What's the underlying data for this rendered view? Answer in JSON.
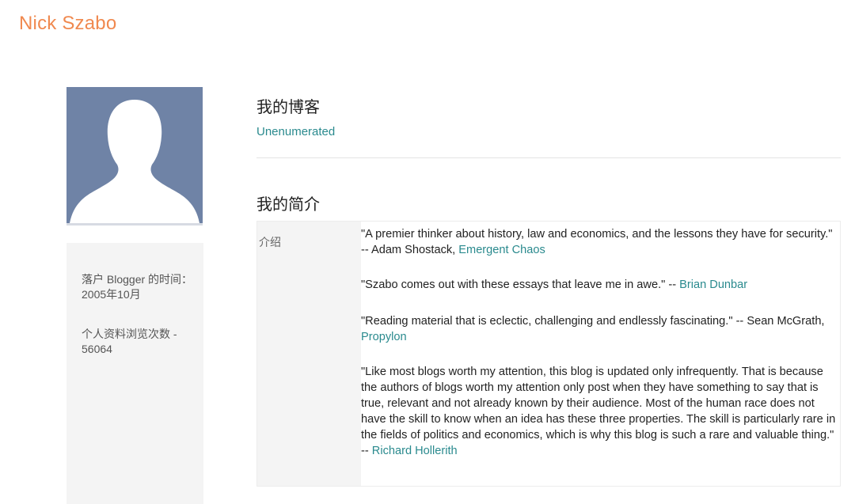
{
  "site": {
    "title": "Nick Szabo"
  },
  "sidebar": {
    "avatar_icon": "default-user-silhouette-icon",
    "member_since_label": "落户 Blogger 的时间：",
    "member_since_value": "2005年10月",
    "profile_views_label": "个人资料浏览次数 -",
    "profile_views_value": "56064"
  },
  "main": {
    "blogs_heading": "我的博客",
    "blog_link": "Unenumerated",
    "intro_heading": "我的简介",
    "intro_label": "介绍",
    "quotes": [
      {
        "text": "\"A premier thinker about history, law and economics, and the lessons they have for security.\" -- Adam Shostack, ",
        "link": "Emergent Chaos"
      },
      {
        "text": "\"Szabo comes out with these essays that leave me in awe.\" -- ",
        "link": "Brian Dunbar"
      },
      {
        "text": "\"Reading material that is eclectic, challenging and endlessly fascinating.\" -- Sean McGrath, ",
        "link": "Propylon"
      },
      {
        "text": "\"Like most blogs worth my attention, this blog is updated only infrequently. That is because the authors of blogs worth my attention only post when they have something to say that is true, relevant and not already known by their audience. Most of the human race does not have the skill to know when an idea has these three properties. The skill is particularly rare in the fields of politics and economics, which is why this blog is such a rare and valuable thing.\" -- ",
        "link": "Richard Hollerith"
      }
    ]
  },
  "colors": {
    "title_accent": "#f0894f",
    "link": "#2a8a8e",
    "avatar_bg": "#6f83a6",
    "panel_bg": "#f4f4f4"
  }
}
